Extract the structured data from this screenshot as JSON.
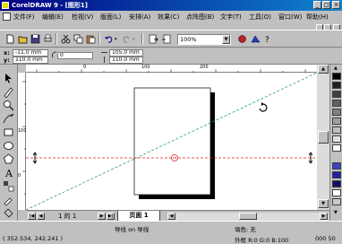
{
  "window": {
    "title": "CorelDRAW 9 - [图形1]",
    "min": "_",
    "max": "□",
    "close": "×"
  },
  "menu": [
    {
      "label": "文件(F)"
    },
    {
      "label": "编辑(E)"
    },
    {
      "label": "检视(V)"
    },
    {
      "label": "版面(L)"
    },
    {
      "label": "安排(A)"
    },
    {
      "label": "效果(C)"
    },
    {
      "label": "点阵图(B)"
    },
    {
      "label": "文字(T)"
    },
    {
      "label": "工具(O)"
    },
    {
      "label": "窗口(W)"
    },
    {
      "label": "帮助(H)"
    }
  ],
  "toolbar": {
    "zoom": "100%"
  },
  "propbar": {
    "x_label": "x:",
    "x_value": "-11.0 mm",
    "y_label": "y:",
    "y_value": "110.0 mm",
    "angle": "0",
    "w_value": "105.0 mm",
    "h_value": "110.0 mm"
  },
  "ruler": {
    "top_ticks": [
      "0",
      "100",
      "200"
    ],
    "left_ticks": [
      "0",
      "100"
    ]
  },
  "pagebar": {
    "count": "1 的 1",
    "tab": "页面 1"
  },
  "status": {
    "coords": "( 352.534, 242.241 )",
    "object": "导线 on 导线",
    "fill": "填色: 无",
    "outline": "外框 R:0 G:0 B:100",
    "outline_size": "000 50"
  },
  "colors": {
    "titlebar_start": "#000080",
    "titlebar_end": "#1084d0",
    "guide_diag": "#2aa35a",
    "guide_horiz": "#e02020"
  },
  "palette": [
    "#000000",
    "#202020",
    "#404040",
    "#606060",
    "#808080",
    "#a0a0a0",
    "#c0c0c0",
    "#e0e0e0",
    "#ffffff",
    "#4040c0",
    "#2020a0",
    "#101060",
    "#ffffff",
    "#c8c8c8"
  ]
}
